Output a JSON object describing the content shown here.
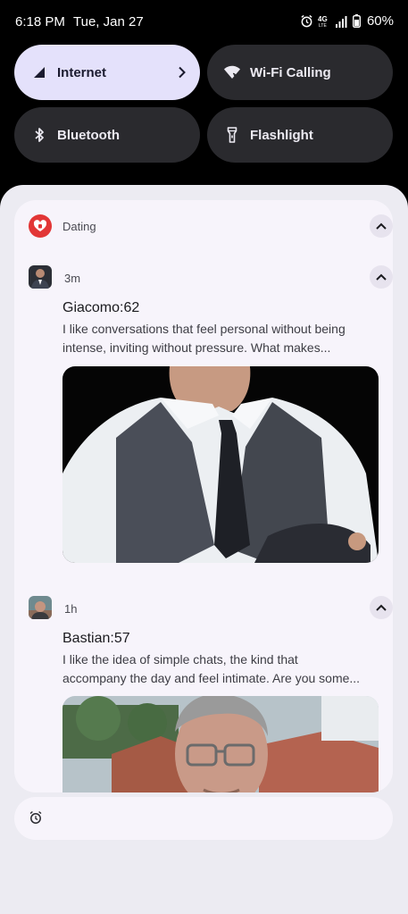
{
  "status_bar": {
    "time": "6:18 PM",
    "date": "Tue, Jan 27",
    "network": "4G LTE",
    "battery": "60%",
    "icons": [
      "alarm-icon",
      "network-type-icon",
      "signal-icon",
      "battery-icon"
    ]
  },
  "quick_settings": [
    {
      "label": "Internet",
      "icon": "signal-icon",
      "state": "on",
      "has_chevron": true
    },
    {
      "label": "Wi-Fi Calling",
      "icon": "wifi-calling-icon",
      "state": "off"
    },
    {
      "label": "Bluetooth",
      "icon": "bluetooth-icon",
      "state": "off"
    },
    {
      "label": "Flashlight",
      "icon": "flashlight-icon",
      "state": "off"
    }
  ],
  "notification_group": {
    "app_name": "Dating",
    "app_color": "#e23636",
    "notifications": [
      {
        "time": "3m",
        "title": "Giacomo:62",
        "body_line1": "I like conversations that feel personal without being",
        "body_line2": "intense, inviting without pressure. What makes..."
      },
      {
        "time": "1h",
        "title": "Bastian:57",
        "body_line1": "I like the idea of simple chats, the kind that",
        "body_line2": "accompany the day and feel intimate. Are you some..."
      }
    ]
  },
  "footer": {
    "icon": "alarm-icon"
  },
  "colors": {
    "accent_tile": "#e4e1fb",
    "dark_tile": "#2a2a2e",
    "shade_bg": "#ecebf2",
    "card_bg": "#f7f4fb"
  }
}
